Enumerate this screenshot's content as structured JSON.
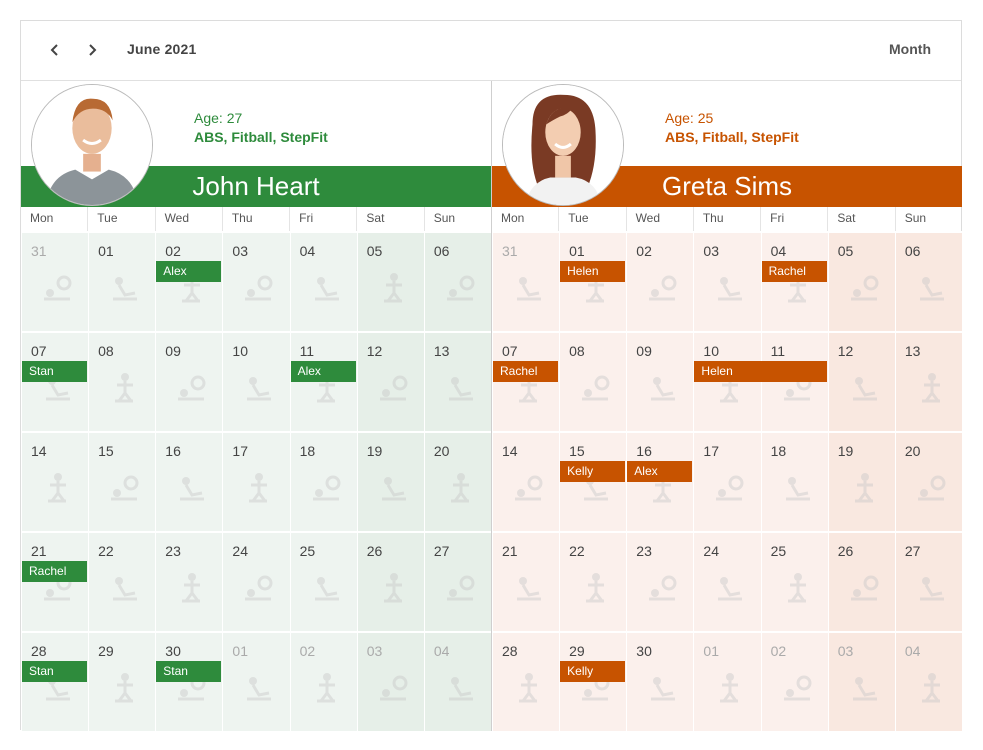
{
  "toolbar": {
    "prev_icon": "chevron-left-icon",
    "next_icon": "chevron-right-icon",
    "date_label": "June 2021",
    "view_label": "Month"
  },
  "colors": {
    "john_accent": "#2e8b3c",
    "greta_accent": "#c75300"
  },
  "weekdays": [
    "Mon",
    "Tue",
    "Wed",
    "Thu",
    "Fri",
    "Sat",
    "Sun"
  ],
  "resources": [
    {
      "name": "John Heart",
      "age": "Age: 27",
      "skills": "ABS, Fitball, StepFit",
      "days": [
        "31",
        "01",
        "02",
        "03",
        "04",
        "05",
        "06",
        "07",
        "08",
        "09",
        "10",
        "11",
        "12",
        "13",
        "14",
        "15",
        "16",
        "17",
        "18",
        "19",
        "20",
        "21",
        "22",
        "23",
        "24",
        "25",
        "26",
        "27",
        "28",
        "29",
        "30",
        "01",
        "02",
        "03",
        "04"
      ],
      "appointments": [
        {
          "text": "Alex",
          "day": "02"
        },
        {
          "text": "Stan",
          "day": "07"
        },
        {
          "text": "Alex",
          "day": "11"
        },
        {
          "text": "Rachel",
          "day": "21"
        },
        {
          "text": "Stan",
          "day": "28"
        },
        {
          "text": "Stan",
          "day": "30"
        }
      ]
    },
    {
      "name": "Greta Sims",
      "age": "Age: 25",
      "skills": "ABS, Fitball, StepFit",
      "days": [
        "31",
        "01",
        "02",
        "03",
        "04",
        "05",
        "06",
        "07",
        "08",
        "09",
        "10",
        "11",
        "12",
        "13",
        "14",
        "15",
        "16",
        "17",
        "18",
        "19",
        "20",
        "21",
        "22",
        "23",
        "24",
        "25",
        "26",
        "27",
        "28",
        "29",
        "30",
        "01",
        "02",
        "03",
        "04"
      ],
      "appointments": [
        {
          "text": "Helen",
          "day": "01"
        },
        {
          "text": "Rachel",
          "day": "04"
        },
        {
          "text": "Rachel",
          "day": "07"
        },
        {
          "text": "Helen",
          "day": "10 – 11"
        },
        {
          "text": "Kelly",
          "day": "15"
        },
        {
          "text": "Alex",
          "day": "16"
        },
        {
          "text": "Kelly",
          "day": "29"
        }
      ]
    }
  ]
}
